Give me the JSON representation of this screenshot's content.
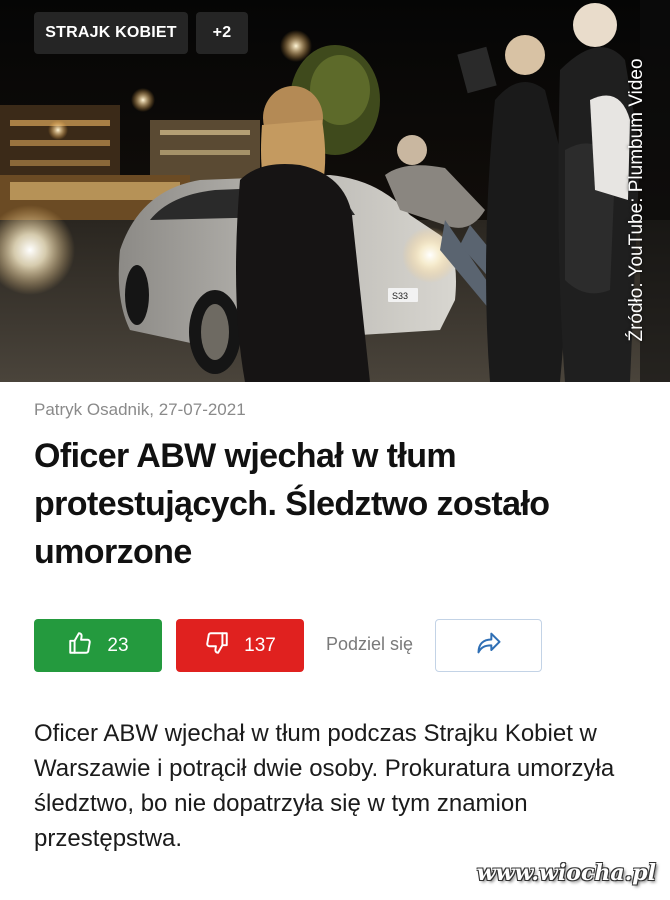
{
  "hero": {
    "tags": {
      "main": "STRAJK KOBIET",
      "more": "+2"
    },
    "credit": "Źródło: YouTube: Plumbum Video",
    "plate": "S33"
  },
  "article": {
    "byline": "Patryk Osadnik, 27-07-2021",
    "title": "Oficer ABW wjechał w tłum protestujących. Śledztwo zostało umorzone",
    "lead": "Oficer ABW wjechał w tłum podczas Strajku Kobiet w Warszawie i potrącił dwie osoby. Prokuratura umorzyła śledztwo, bo nie dopatrzyła się w tym znamion przestępstwa."
  },
  "actions": {
    "likes": "23",
    "dislikes": "137",
    "share_label": "Podziel się",
    "like_icon": "thumbs-up-icon",
    "dislike_icon": "thumbs-down-icon",
    "share_icon": "share-arrow-icon"
  },
  "watermark": "www.wiocha.pl",
  "colors": {
    "like": "#249a3e",
    "dislike": "#e0211f",
    "share_border": "#c3d3e6",
    "share_icon": "#2f6fb5"
  }
}
